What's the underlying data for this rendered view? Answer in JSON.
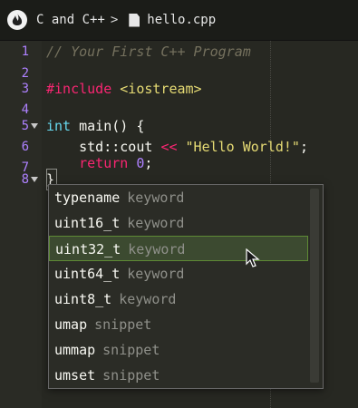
{
  "header": {
    "logo_icon": "flame-logo-icon",
    "breadcrumb_folder": "C and C++",
    "breadcrumb_sep": ">",
    "file_icon": "file-icon",
    "file_name": "hello.cpp"
  },
  "editor": {
    "lines": [
      {
        "num": "1"
      },
      {
        "num": "2"
      },
      {
        "num": "3"
      },
      {
        "num": "4"
      },
      {
        "num": "5"
      },
      {
        "num": "6"
      },
      {
        "num": "7"
      },
      {
        "num": "8"
      }
    ],
    "code": {
      "l1": "// Your First C++ Program",
      "l3_directive": "#include",
      "l3_header": "<iostream>",
      "l5_type": "int",
      "l5_fn": "main",
      "l5_rest": "() {",
      "l6_indent": "    ",
      "l6_ns": "std::cout",
      "l6_op": "<<",
      "l6_str": "\"Hello World!\"",
      "l6_end": ";",
      "l7_indent": "    ",
      "l7_kw": "return",
      "l7_num": "0",
      "l7_end": ";",
      "l8": "}"
    }
  },
  "autocomplete": {
    "items": [
      {
        "label": "typename",
        "kind": "keyword"
      },
      {
        "label": "uint16_t",
        "kind": "keyword"
      },
      {
        "label": "uint32_t",
        "kind": "keyword"
      },
      {
        "label": "uint64_t",
        "kind": "keyword"
      },
      {
        "label": "uint8_t",
        "kind": "keyword"
      },
      {
        "label": "umap",
        "kind": "snippet"
      },
      {
        "label": "ummap",
        "kind": "snippet"
      },
      {
        "label": "umset",
        "kind": "snippet"
      }
    ],
    "selected_index": 2
  },
  "colors": {
    "background": "#272822",
    "selection": "#3c4a30",
    "selection_border": "#5e8a35"
  }
}
